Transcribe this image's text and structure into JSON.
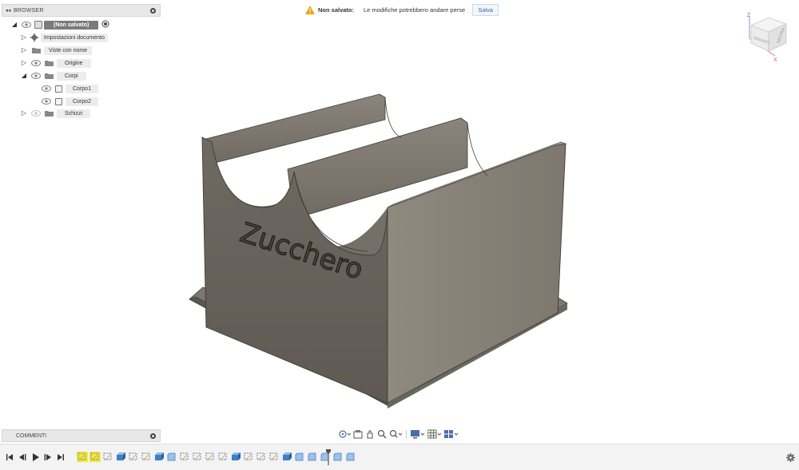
{
  "browser": {
    "title": "BROWSER",
    "root_label": "(Non salvato)",
    "items": [
      {
        "label": "Impostazioni documento"
      },
      {
        "label": "Viste con nome"
      },
      {
        "label": "Origine"
      },
      {
        "label": "Corpi"
      },
      {
        "label": "Corpo1"
      },
      {
        "label": "Corpo2"
      },
      {
        "label": "Schizzi"
      }
    ]
  },
  "banner": {
    "status": "Non salvato:",
    "message": "Le modifiche potrebbero andare perse",
    "save_label": "Salva"
  },
  "comments": {
    "title": "COMMENTI"
  },
  "model": {
    "engraved_text": "Zucchero"
  },
  "viewcube": {
    "face_left": "DAVANTI",
    "face_right": "DESTRA",
    "axis_z": "Z",
    "axis_x": "X"
  },
  "colors": {
    "accent": "#2a6db3",
    "highlight": "#f2ea37",
    "model": "#8a857b",
    "warning": "#f0a30a"
  },
  "timeline": {
    "feature_icons": [
      "sketch",
      "sketch",
      "sketch",
      "extrude",
      "sketch",
      "sketch",
      "extrude",
      "fillet",
      "sketch",
      "sketch",
      "sketch",
      "sketch",
      "extrude",
      "sketch",
      "sketch",
      "sketch",
      "extrude",
      "fillet",
      "fillet",
      "fillet",
      "fillet",
      "fillet"
    ]
  }
}
